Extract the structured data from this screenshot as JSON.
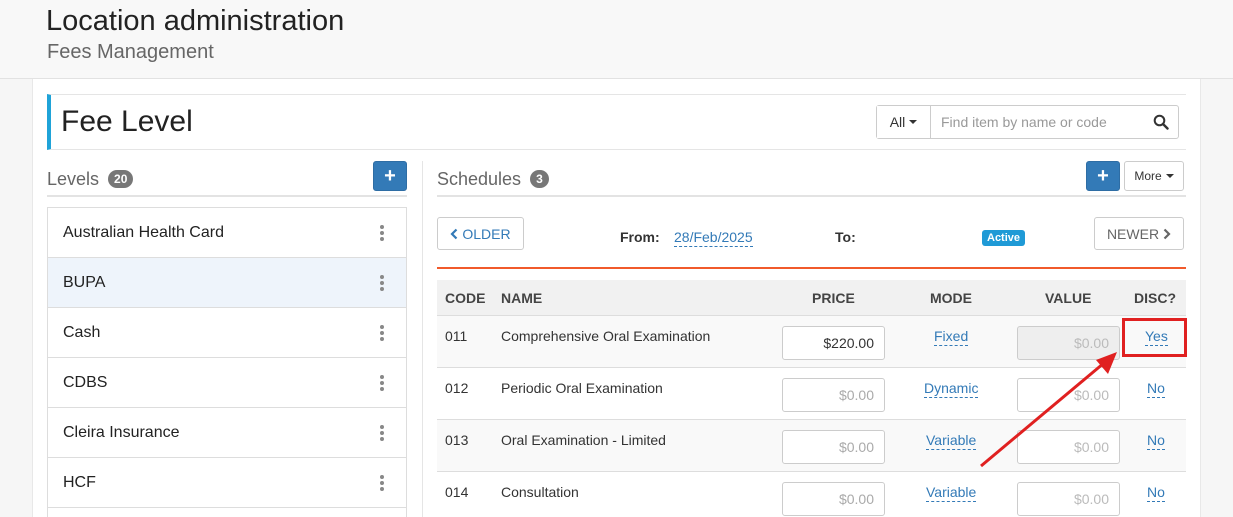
{
  "header": {
    "title": "Location administration",
    "subtitle": "Fees Management"
  },
  "fee_level": {
    "title": "Fee Level",
    "filter_label": "All",
    "search_placeholder": "Find item by name or code"
  },
  "levels": {
    "label": "Levels",
    "count": "20",
    "add_label": "+",
    "items": [
      {
        "label": "Australian Health Card"
      },
      {
        "label": "BUPA"
      },
      {
        "label": "Cash"
      },
      {
        "label": "CDBS"
      },
      {
        "label": "Cleira Insurance"
      },
      {
        "label": "HCF"
      }
    ]
  },
  "schedules": {
    "label": "Schedules",
    "count": "3",
    "add_label": "+",
    "more_label": "More",
    "older_label": "OLDER",
    "newer_label": "NEWER",
    "from_label": "From:",
    "from_date": "28/Feb/2025",
    "to_label": "To:",
    "status": "Active"
  },
  "table": {
    "headers": {
      "code": "CODE",
      "name": "NAME",
      "price": "PRICE",
      "mode": "MODE",
      "value": "VALUE",
      "disc": "DISC?"
    },
    "rows": [
      {
        "code": "011",
        "name": "Comprehensive Oral Examination",
        "price": "$220.00",
        "mode": "Fixed",
        "value": "$0.00",
        "disc": "Yes"
      },
      {
        "code": "012",
        "name": "Periodic Oral Examination",
        "price": "$0.00",
        "mode": "Dynamic",
        "value": "$0.00",
        "disc": "No"
      },
      {
        "code": "013",
        "name": "Oral Examination - Limited",
        "price": "$0.00",
        "mode": "Variable",
        "value": "$0.00",
        "disc": "No"
      },
      {
        "code": "014",
        "name": "Consultation",
        "price": "$0.00",
        "mode": "Variable",
        "value": "$0.00",
        "disc": "No"
      }
    ]
  },
  "colors": {
    "accent": "#1fa3d8",
    "primary": "#337ab7",
    "divider": "#f15a2b",
    "annotation": "#e02020"
  }
}
